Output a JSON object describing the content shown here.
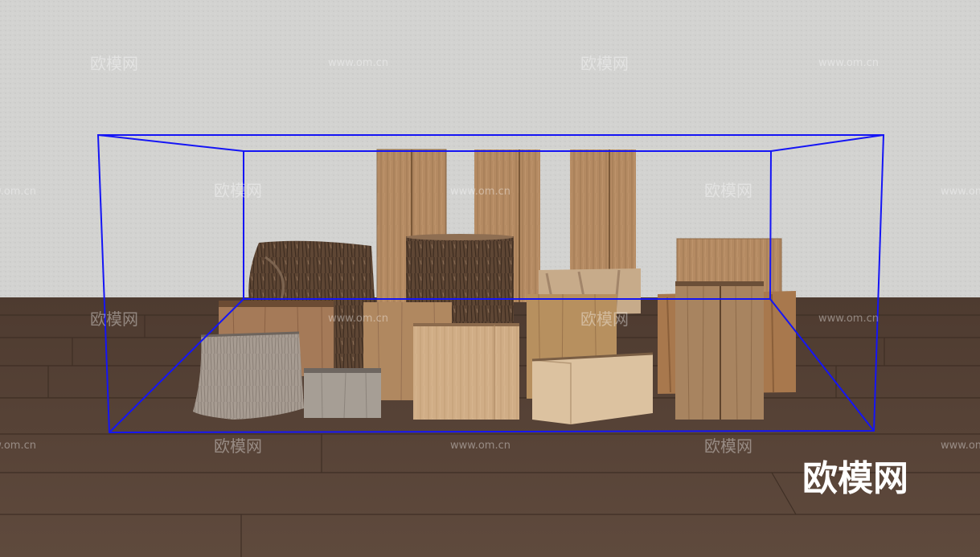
{
  "watermark": {
    "brand": "欧模网",
    "url": "www.om.cn",
    "color": "#ffffff"
  },
  "logo": {
    "text": "欧模网",
    "color": "#ffffff"
  },
  "colors": {
    "wall": "#d2d2d0",
    "floor": "#5a4538",
    "bounding_box": "#1515f5"
  }
}
